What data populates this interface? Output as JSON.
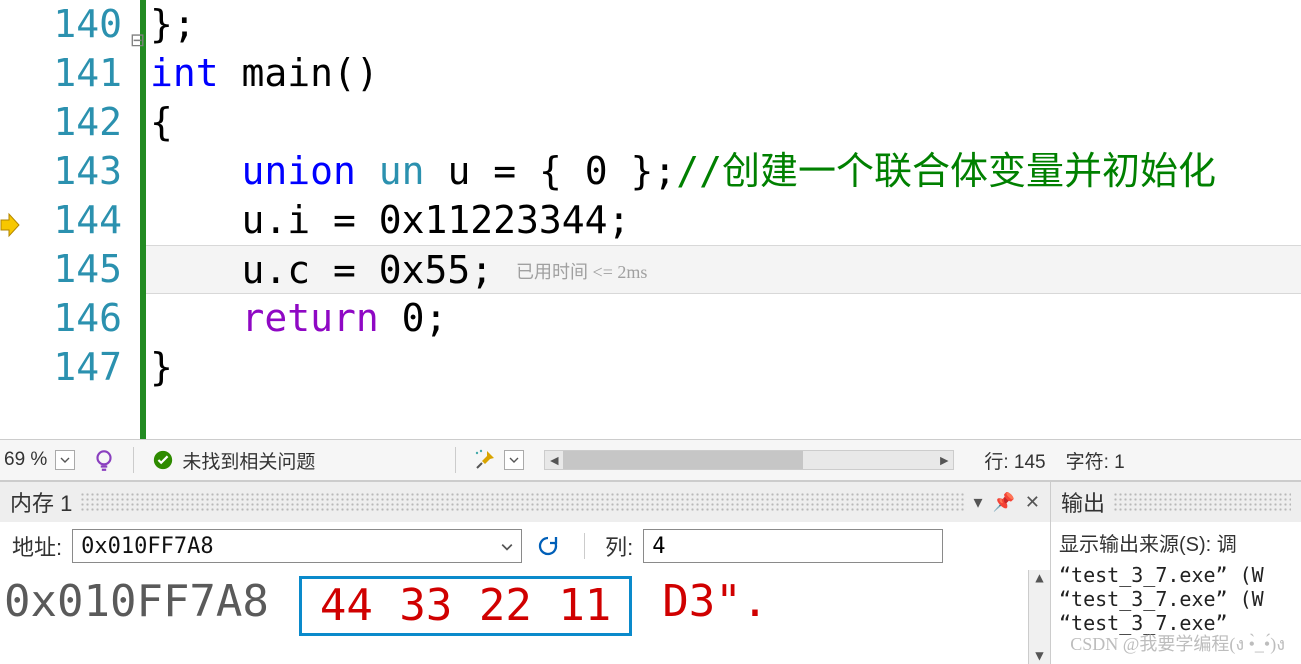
{
  "code": {
    "lines": [
      {
        "num": "140",
        "html": "{};"
      },
      {
        "num": "141",
        "html": "int main()"
      },
      {
        "num": "142",
        "html": "{"
      },
      {
        "num": "143",
        "html": "    union un u = { 0 };//创建一个联合体变量并初始化"
      },
      {
        "num": "144",
        "html": "    u.i = 0x11223344;"
      },
      {
        "num": "145",
        "html": "    u.c = 0x55;"
      },
      {
        "num": "146",
        "html": "    return 0;"
      },
      {
        "num": "147",
        "html": "}"
      }
    ],
    "ln140": "140",
    "ln141": "141",
    "ln142": "142",
    "ln143": "143",
    "ln144": "144",
    "ln145": "145",
    "ln146": "146",
    "ln147": "147",
    "hint": "已用时间 <= 2ms"
  },
  "status": {
    "zoom": "69 %",
    "issues": "未找到相关问题",
    "line": "行: 145",
    "char": "字符: 1"
  },
  "memory": {
    "panel_title": "内存 1",
    "addr_label": "地址:",
    "addr_value": "0x010FF7A8",
    "col_label": "列:",
    "col_value": "4",
    "row_addr": "0x010FF7A8",
    "row_bytes": "44 33 22 11",
    "row_ascii": "D3\"."
  },
  "output": {
    "panel_title": "输出",
    "source_label": "显示输出来源(S):",
    "source_value": "调",
    "line1": "“test_3_7.exe” (W",
    "line2": "“test_3_7.exe” (W",
    "line3": "“test_3_7.exe”"
  },
  "watermark": "CSDN @我要学编程(ง •̀_•́)ง"
}
